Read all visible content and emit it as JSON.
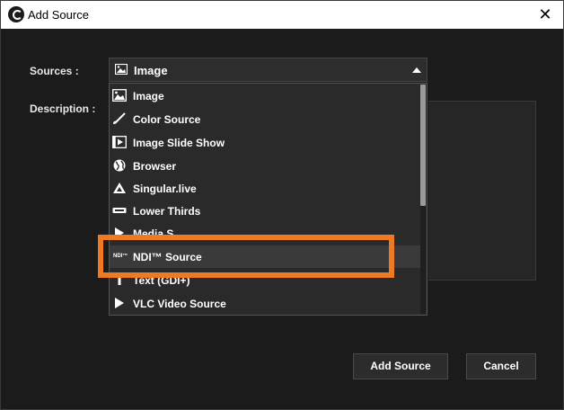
{
  "window": {
    "title": "Add Source",
    "close_glyph": "✕"
  },
  "form": {
    "sources_label": "Sources :",
    "description_label": "Description :",
    "selected_source": "Image"
  },
  "dropdown": {
    "items": [
      {
        "label": "Image",
        "icon": "image-icon"
      },
      {
        "label": "Color Source",
        "icon": "brush-icon"
      },
      {
        "label": "Image Slide Show",
        "icon": "slideshow-icon"
      },
      {
        "label": "Browser",
        "icon": "globe-icon"
      },
      {
        "label": "Singular.live",
        "icon": "singular-icon"
      },
      {
        "label": "Lower Thirds",
        "icon": "lower-thirds-icon"
      },
      {
        "label": "Media S",
        "icon": "play-icon"
      },
      {
        "label": "NDI™ Source",
        "icon": "ndi-icon",
        "icon_text": "NDI™"
      },
      {
        "label": "Text (GDI+)",
        "icon": "text-icon"
      },
      {
        "label": "VLC Video Source",
        "icon": "play-icon"
      }
    ],
    "selected_index": 7
  },
  "buttons": {
    "add": "Add Source",
    "cancel": "Cancel"
  },
  "colors": {
    "highlight": "#f07a22",
    "background": "#1b1b1b"
  }
}
